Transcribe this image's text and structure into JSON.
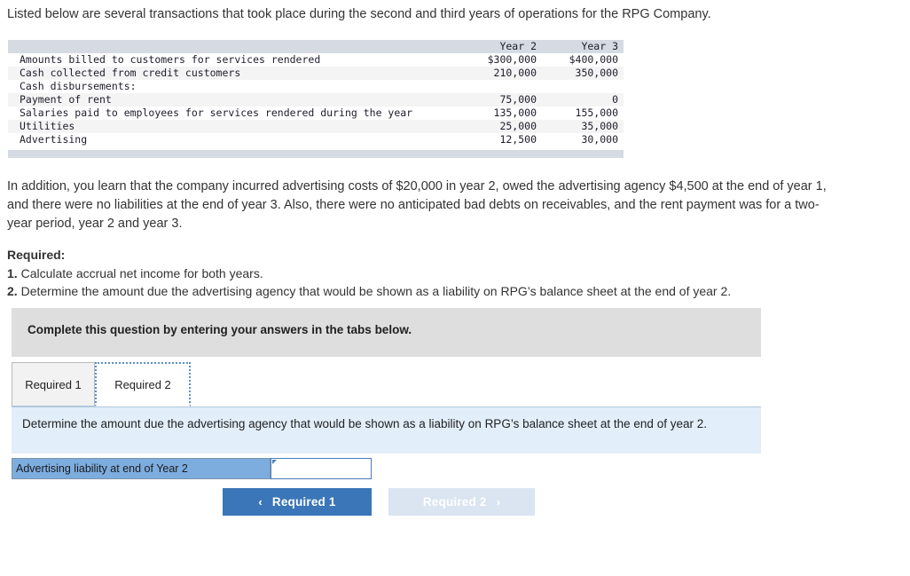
{
  "intro": {
    "text": "Listed below are several transactions that took place during the second and third years of operations for the RPG Company."
  },
  "table": {
    "columns": [
      "",
      "Year 2",
      "Year 3"
    ],
    "rows": [
      {
        "label": "Amounts billed to customers for services rendered",
        "year2": "$300,000",
        "year3": "$400,000"
      },
      {
        "label": "Cash collected from credit customers",
        "year2": "210,000",
        "year3": "350,000"
      },
      {
        "label": "Cash disbursements:",
        "year2": "",
        "year3": ""
      },
      {
        "label": "Payment of rent",
        "year2": "75,000",
        "year3": "0"
      },
      {
        "label": "Salaries paid to employees for services rendered during the year",
        "year2": "135,000",
        "year3": "155,000"
      },
      {
        "label": "Utilities",
        "year2": "25,000",
        "year3": "35,000"
      },
      {
        "label": "Advertising",
        "year2": "12,500",
        "year3": "30,000"
      }
    ]
  },
  "additional": {
    "text": "In addition, you learn that the company incurred advertising costs of $20,000 in year 2, owed the advertising agency $4,500 at the end of year 1, and there were no liabilities at the end of year 3. Also, there were no anticipated bad debts on receivables, and the rent payment was for a two-year period, year 2 and year 3."
  },
  "required": {
    "heading": "Required:",
    "items": [
      {
        "num": "1.",
        "text": "Calculate accrual net income for both years."
      },
      {
        "num": "2.",
        "text": "Determine the amount due the advertising agency that would be shown as a liability on RPG’s balance sheet at the end of year 2."
      }
    ]
  },
  "instruction_banner": {
    "text": "Complete this question by entering your answers in the tabs below."
  },
  "tabs": [
    {
      "label": "Required 1",
      "active": false
    },
    {
      "label": "Required 2",
      "active": true
    }
  ],
  "question_panel": {
    "text": "Determine the amount due the advertising agency that would be shown as a liability on RPG’s balance sheet at the end of year 2."
  },
  "answer_row": {
    "label": "Advertising liability at end of Year 2",
    "value": "",
    "placeholder": ""
  },
  "nav": {
    "prev": {
      "label": "Required 1",
      "icon": "chevron-left-icon",
      "glyph": "‹"
    },
    "next": {
      "label": "Required 2",
      "icon": "chevron-right-icon",
      "glyph": "›",
      "disabled": true
    }
  },
  "colors": {
    "accent_blue": "#3a76b8",
    "disabled_blue": "#dae5f1",
    "panel_blue": "#e2eef9",
    "label_blue": "#7daddf",
    "banner_gray": "#dedede",
    "table_header_gray": "#d5dae3"
  }
}
